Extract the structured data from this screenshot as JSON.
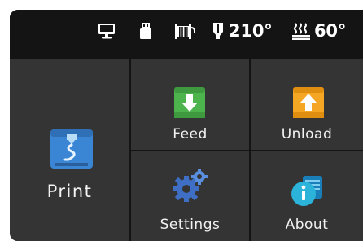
{
  "status_bar": {
    "icons": [
      "monitor-icon",
      "usb-drive-icon",
      "filament-spool-icon",
      "nozzle-icon",
      "heated-bed-icon"
    ],
    "nozzle_temp": "210°",
    "bed_temp": "60°"
  },
  "menu": {
    "print_label": "Print",
    "feed_label": "Feed",
    "unload_label": "Unload",
    "settings_label": "Settings",
    "about_label": "About"
  },
  "colors": {
    "background": "#141414",
    "tile": "#343434",
    "feed_green": "#4db34d",
    "unload_orange": "#f5a623",
    "print_blue": "#3a86d4",
    "settings_blue": "#3e6fc4",
    "about_cyan": "#2bb3d9"
  }
}
